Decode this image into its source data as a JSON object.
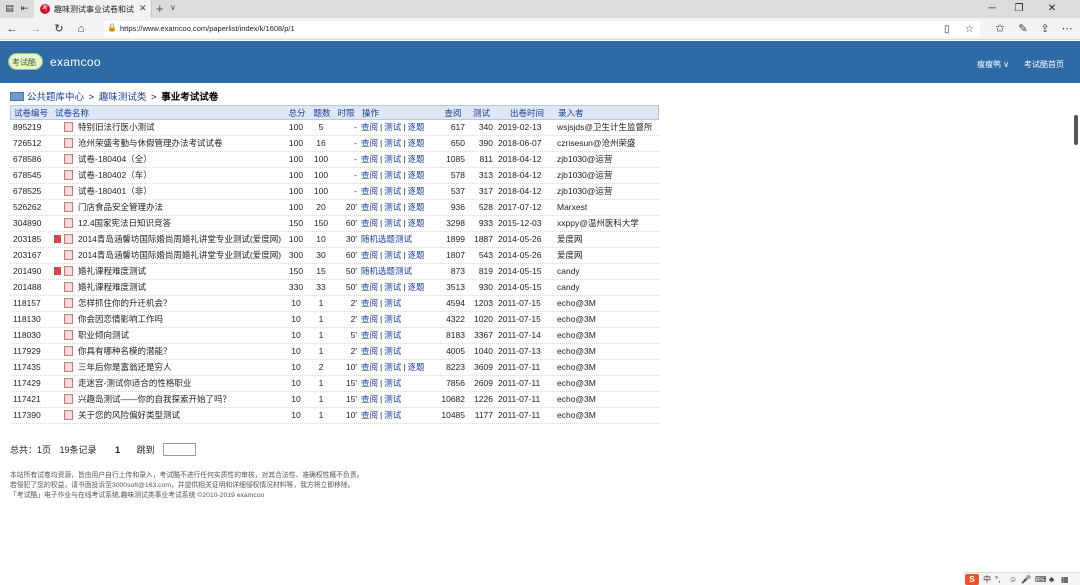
{
  "browser": {
    "tab_title": "趣味测试事业试卷和试题",
    "url": "https://www.examcoo.com/paperlist/index/k/1608/p/1"
  },
  "header": {
    "logo_badge": "考试酷",
    "logo_text": "examcoo",
    "user_menu": "瘦瘦鸭 ∨",
    "home_link": "考试酷首页"
  },
  "breadcrumb": {
    "root": "公共题库中心",
    "category": "趣味测试类",
    "current": "事业考试试卷",
    "sep": ">"
  },
  "table": {
    "headers": [
      "试卷编号",
      "试卷名称",
      "总分",
      "题数",
      "时限",
      "操作",
      "查阅",
      "测试",
      "出卷时间",
      "录入者"
    ],
    "rows": [
      {
        "id": "895219",
        "name": "特别旧法行医小测试",
        "score": "100",
        "count": "5",
        "time": "-",
        "ops": [
          "查阅",
          "测试",
          "逐题"
        ],
        "views": "617",
        "tests": "340",
        "date": "2019-02-13",
        "author": "wsjsjds@卫生计生监督所",
        "extra_icon": false
      },
      {
        "id": "726512",
        "name": "沧州荣盛考勤与休假管理办法考试试卷",
        "score": "100",
        "count": "16",
        "time": "-",
        "ops": [
          "查阅",
          "测试",
          "逐题"
        ],
        "views": "650",
        "tests": "390",
        "date": "2018-06-07",
        "author": "czrisesun@沧州荣盛",
        "extra_icon": false
      },
      {
        "id": "678586",
        "name": "试卷-180404（全）",
        "score": "100",
        "count": "100",
        "time": "-",
        "ops": [
          "查阅",
          "测试",
          "逐题"
        ],
        "views": "1085",
        "tests": "811",
        "date": "2018-04-12",
        "author": "zjb1030@运营",
        "extra_icon": false
      },
      {
        "id": "678545",
        "name": "试卷-180402（车）",
        "score": "100",
        "count": "100",
        "time": "-",
        "ops": [
          "查阅",
          "测试",
          "逐题"
        ],
        "views": "578",
        "tests": "313",
        "date": "2018-04-12",
        "author": "zjb1030@运营",
        "extra_icon": false
      },
      {
        "id": "678525",
        "name": "试卷-180401（非）",
        "score": "100",
        "count": "100",
        "time": "-",
        "ops": [
          "查阅",
          "测试",
          "逐题"
        ],
        "views": "537",
        "tests": "317",
        "date": "2018-04-12",
        "author": "zjb1030@运营",
        "extra_icon": false
      },
      {
        "id": "526262",
        "name": "门店食品安全管理办法",
        "score": "100",
        "count": "20",
        "time": "20'",
        "ops": [
          "查阅",
          "测试",
          "逐题"
        ],
        "views": "936",
        "tests": "528",
        "date": "2017-07-12",
        "author": "Marxest",
        "extra_icon": false
      },
      {
        "id": "304890",
        "name": "12.4国家宪法日知识竞答",
        "score": "150",
        "count": "150",
        "time": "60'",
        "ops": [
          "查阅",
          "测试",
          "逐题"
        ],
        "views": "3298",
        "tests": "933",
        "date": "2015-12-03",
        "author": "xxppy@温州医科大学",
        "extra_icon": false
      },
      {
        "id": "203185",
        "name": "2014青岛涵馨坊国际婚尚周婚礼讲堂专业测试(爱度网)",
        "score": "100",
        "count": "10",
        "time": "30'",
        "ops": [
          "随机选题测试"
        ],
        "views": "1899",
        "tests": "1887",
        "date": "2014-05-26",
        "author": "爱度网",
        "extra_icon": true
      },
      {
        "id": "203167",
        "name": "2014青岛涵馨坊国际婚尚周婚礼讲堂专业测试(爱度网)",
        "score": "300",
        "count": "30",
        "time": "60'",
        "ops": [
          "查阅",
          "测试",
          "逐题"
        ],
        "views": "1807",
        "tests": "543",
        "date": "2014-05-26",
        "author": "爱度网",
        "extra_icon": false
      },
      {
        "id": "201490",
        "name": "婚礼课程难度测试",
        "score": "150",
        "count": "15",
        "time": "50'",
        "ops": [
          "随机选题测试"
        ],
        "views": "873",
        "tests": "819",
        "date": "2014-05-15",
        "author": "candy",
        "extra_icon": true
      },
      {
        "id": "201488",
        "name": "婚礼课程难度测试",
        "score": "330",
        "count": "33",
        "time": "50'",
        "ops": [
          "查阅",
          "测试",
          "逐题"
        ],
        "views": "3513",
        "tests": "930",
        "date": "2014-05-15",
        "author": "candy",
        "extra_icon": false
      },
      {
        "id": "118157",
        "name": "怎样抓住你的升迁机会？",
        "score": "10",
        "count": "1",
        "time": "2'",
        "ops": [
          "查阅",
          "测试"
        ],
        "views": "4594",
        "tests": "1203",
        "date": "2011-07-15",
        "author": "echo@3M",
        "extra_icon": false
      },
      {
        "id": "118130",
        "name": "你会因恋情影响工作吗",
        "score": "10",
        "count": "1",
        "time": "2'",
        "ops": [
          "查阅",
          "测试"
        ],
        "views": "4322",
        "tests": "1020",
        "date": "2011-07-15",
        "author": "echo@3M",
        "extra_icon": false
      },
      {
        "id": "118030",
        "name": "职业倾向测试",
        "score": "10",
        "count": "1",
        "time": "5'",
        "ops": [
          "查阅",
          "测试"
        ],
        "views": "8183",
        "tests": "3367",
        "date": "2011-07-14",
        "author": "echo@3M",
        "extra_icon": false
      },
      {
        "id": "117929",
        "name": "你具有哪种名模的潜能？",
        "score": "10",
        "count": "1",
        "time": "2'",
        "ops": [
          "查阅",
          "测试"
        ],
        "views": "4005",
        "tests": "1040",
        "date": "2011-07-13",
        "author": "echo@3M",
        "extra_icon": false
      },
      {
        "id": "117435",
        "name": "三年后你是富翁还是穷人",
        "score": "10",
        "count": "2",
        "time": "10'",
        "ops": [
          "查阅",
          "测试",
          "逐题"
        ],
        "views": "8223",
        "tests": "3609",
        "date": "2011-07-11",
        "author": "echo@3M",
        "extra_icon": false
      },
      {
        "id": "117429",
        "name": "走迷宫-测试你适合的性格职业",
        "score": "10",
        "count": "1",
        "time": "15'",
        "ops": [
          "查阅",
          "测试"
        ],
        "views": "7856",
        "tests": "2609",
        "date": "2011-07-11",
        "author": "echo@3M",
        "extra_icon": false
      },
      {
        "id": "117421",
        "name": "兴趣岛测试——你的自我探索开始了吗？",
        "score": "10",
        "count": "1",
        "time": "15'",
        "ops": [
          "查阅",
          "测试"
        ],
        "views": "10682",
        "tests": "1226",
        "date": "2011-07-11",
        "author": "echo@3M",
        "extra_icon": false
      },
      {
        "id": "117390",
        "name": "关于您的风险偏好类型测试",
        "score": "10",
        "count": "1",
        "time": "10'",
        "ops": [
          "查阅",
          "测试"
        ],
        "views": "10485",
        "tests": "1177",
        "date": "2011-07-11",
        "author": "echo@3M",
        "extra_icon": false
      }
    ]
  },
  "pager": {
    "total_pages": "总共：1页",
    "total_records": "19条记录",
    "current_page": "1",
    "jump_label": "跳到"
  },
  "notes": [
    "本站所有试卷均资源，皆由用户自行上传和录入，考试酷不进行任何实质性的审核，对其合法性、准确权性概不负责。",
    "若侵犯了您的权益，请书面投诉至3000soft@163.com，并提供相关证明和详细侵权情况材料等，我方将立即移除。",
    "「考试酷」电子作业与在线考试系统,趣味测试类事业考试系统    ©2010-2019 examcoo"
  ],
  "ime": {
    "logo": "S",
    "lang": "中"
  }
}
